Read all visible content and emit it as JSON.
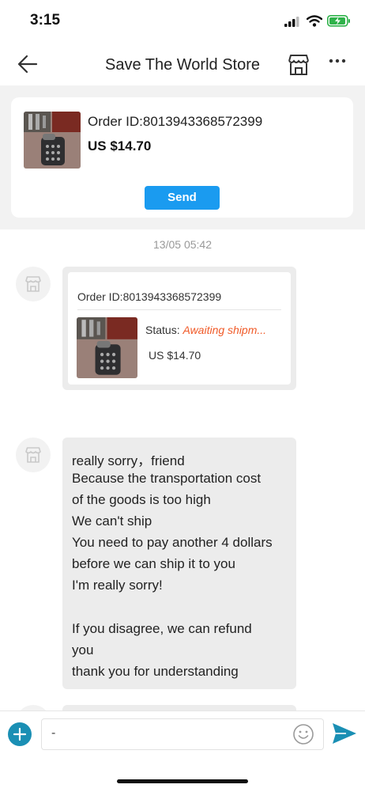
{
  "status_bar": {
    "time": "3:15"
  },
  "nav": {
    "title": "Save The World Store"
  },
  "order_card": {
    "order_id": "Order ID:8013943368572399",
    "price": "US $14.70",
    "send_label": "Send"
  },
  "chat": {
    "timestamp": "13/05 05:42",
    "order_message": {
      "order_id": "Order ID:8013943368572399",
      "status_label": "Status:",
      "status_value": "Awaiting shipm...",
      "price": "US $14.70"
    },
    "text_message": {
      "lines": [
        "really sorry，friend",
        "Because the transportation cost",
        "of the goods is too high",
        "We can't ship",
        "You need to pay another 4 dollars",
        "before we can ship it to you",
        "I'm really sorry!",
        "",
        "If you disagree, we can refund",
        "you",
        "thank you for understanding"
      ]
    }
  },
  "input": {
    "value": "-"
  },
  "colors": {
    "accent_blue": "#1a9bf0",
    "status_orange": "#f05a28",
    "add_button": "#1a8fb4",
    "send_icon": "#1a8fb4"
  },
  "icons": {
    "back": "arrow-left-icon",
    "store": "storefront-icon",
    "more": "more-dots-icon",
    "add": "plus-icon",
    "emoji": "smiley-icon",
    "send": "send-paper-plane-icon"
  }
}
